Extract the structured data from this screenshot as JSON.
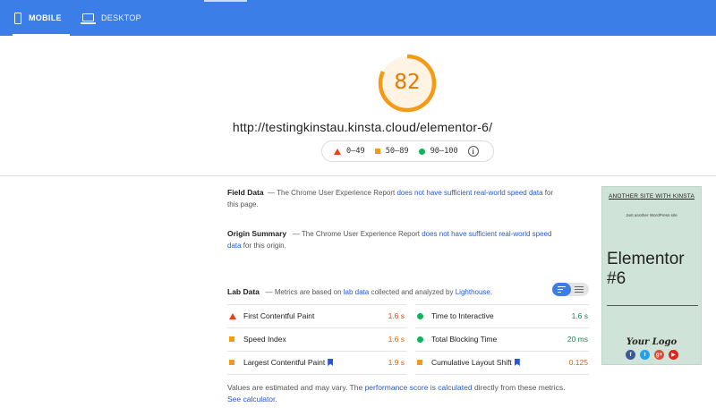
{
  "tabs": [
    {
      "label": "MOBILE",
      "icon": "phone-icon"
    },
    {
      "label": "DESKTOP",
      "icon": "monitor-icon"
    }
  ],
  "score": {
    "value": "82",
    "fraction": 0.82,
    "color": "#e67700"
  },
  "url": "http://testingkinstau.kinsta.cloud/elementor-6/",
  "legend": [
    {
      "range": "0–49",
      "shape": "triangle",
      "color": "#e8430f"
    },
    {
      "range": "50–89",
      "shape": "square",
      "color": "#f39a16"
    },
    {
      "range": "90–100",
      "shape": "circle",
      "color": "#0cb45a"
    }
  ],
  "field_data": {
    "title": "Field Data",
    "pre": "— The Chrome User Experience Report ",
    "link": "does not have sufficient real-world speed data",
    "post": " for this page."
  },
  "origin_summary": {
    "title": "Origin Summary",
    "pre": "— The Chrome User Experience Report ",
    "link": "does not have sufficient real-world speed data",
    "post": " for this origin."
  },
  "lab_data": {
    "title": "Lab Data",
    "pre": "— Metrics are based on ",
    "link1": "lab data",
    "mid": " collected and analyzed by ",
    "link2": "Lighthouse",
    "post": "."
  },
  "metrics": [
    {
      "label": "First Contentful Paint",
      "value": "1.6 s",
      "status": "fail",
      "bookmark": false
    },
    {
      "label": "Time to Interactive",
      "value": "1.6 s",
      "status": "pass",
      "bookmark": false
    },
    {
      "label": "Speed Index",
      "value": "1.6 s",
      "status": "average",
      "bookmark": false
    },
    {
      "label": "Total Blocking Time",
      "value": "20 ms",
      "status": "pass",
      "bookmark": false
    },
    {
      "label": "Largest Contentful Paint",
      "value": "1.9 s",
      "status": "average",
      "bookmark": true
    },
    {
      "label": "Cumulative Layout Shift",
      "value": "0.125",
      "status": "average",
      "bookmark": true
    }
  ],
  "footer": {
    "pre": "Values are estimated and may vary. The ",
    "link1": "performance score is calculated",
    "mid": " directly from these metrics. ",
    "link2": "See calculator",
    "post": "."
  },
  "thumbnail": {
    "site_title": "ANOTHER SITE WITH KINSTA",
    "tagline": "Just another WordPress site",
    "heading": "Elementor #6",
    "logo": "Your Logo",
    "social": [
      {
        "icon": "facebook-icon",
        "glyph": "f",
        "color": "#3b5998"
      },
      {
        "icon": "twitter-icon",
        "glyph": "t",
        "color": "#1da1f2"
      },
      {
        "icon": "google-plus-icon",
        "glyph": "g+",
        "color": "#dd4b39"
      },
      {
        "icon": "youtube-icon",
        "glyph": "▶",
        "color": "#e62117"
      }
    ]
  },
  "colors": {
    "primary": "#3b7ee8",
    "fail": "#e8430f",
    "average": "#f39a16",
    "pass": "#0cb45a",
    "link": "#2758d8"
  }
}
